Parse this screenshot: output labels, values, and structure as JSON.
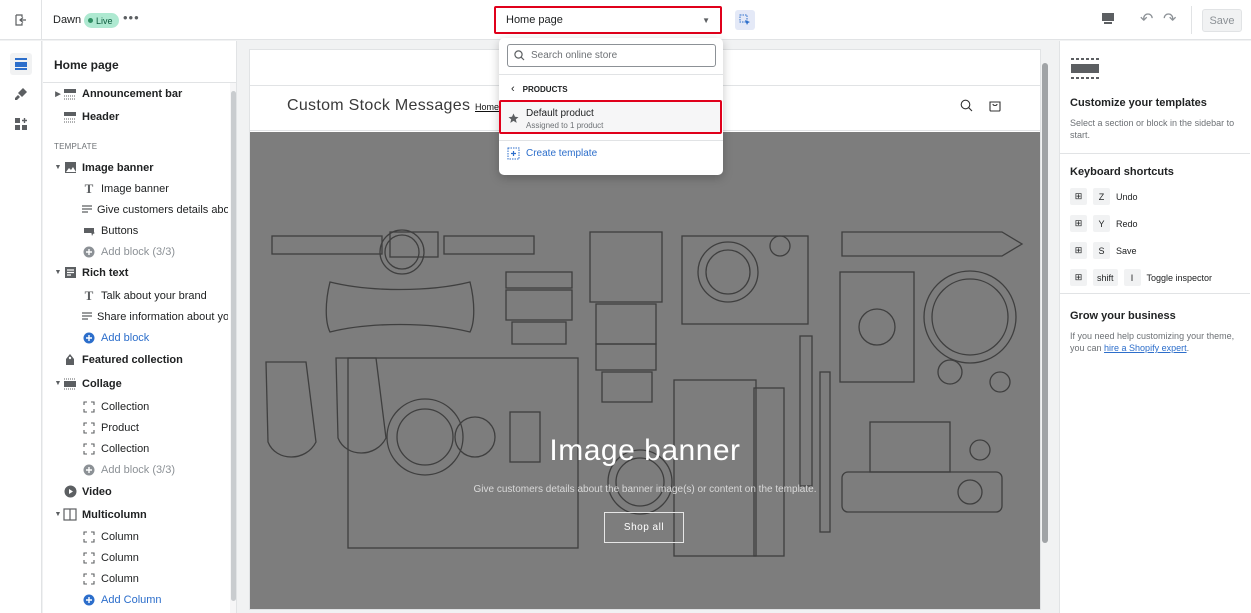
{
  "topbar": {
    "theme_name": "Dawn",
    "live_badge": "Live",
    "more_label": "•••",
    "page_selector": "Home page",
    "save_label": "Save"
  },
  "dropdown": {
    "search_placeholder": "Search online store",
    "back_label": "PRODUCTS",
    "option_name": "Default product",
    "option_meta": "Assigned to 1 product",
    "create_label": "Create template"
  },
  "sidebar": {
    "title": "Home page",
    "section_template": "TEMPLATE",
    "rows": [
      {
        "label": "Announcement bar",
        "style": "bold"
      },
      {
        "label": "Header",
        "style": "bold"
      },
      {
        "label": "Image banner",
        "style": "bold"
      },
      {
        "label": "Image banner",
        "style": "normal"
      },
      {
        "label": "Give customers details abo...",
        "style": "normal"
      },
      {
        "label": "Buttons",
        "style": "normal"
      },
      {
        "label": "Add block (3/3)",
        "style": "gray"
      },
      {
        "label": "Rich text",
        "style": "bold"
      },
      {
        "label": "Talk about your brand",
        "style": "normal"
      },
      {
        "label": "Share information about yo...",
        "style": "normal"
      },
      {
        "label": "Add block",
        "style": "blue"
      },
      {
        "label": "Featured collection",
        "style": "bold"
      },
      {
        "label": "Collage",
        "style": "bold"
      },
      {
        "label": "Collection",
        "style": "normal"
      },
      {
        "label": "Product",
        "style": "normal"
      },
      {
        "label": "Collection",
        "style": "normal"
      },
      {
        "label": "Add block (3/3)",
        "style": "gray"
      },
      {
        "label": "Video",
        "style": "bold"
      },
      {
        "label": "Multicolumn",
        "style": "bold"
      },
      {
        "label": "Column",
        "style": "normal"
      },
      {
        "label": "Column",
        "style": "normal"
      },
      {
        "label": "Column",
        "style": "normal"
      },
      {
        "label": "Add Column",
        "style": "blue"
      }
    ]
  },
  "store": {
    "logo": "Custom Stock Messages",
    "nav_link": "Home",
    "banner_heading": "Image banner",
    "banner_sub": "Give customers details about the banner image(s) or content on the template.",
    "banner_cta": "Shop all"
  },
  "right_panel": {
    "customize_title": "Customize your templates",
    "customize_text": "Select a section or block in the sidebar to start.",
    "shortcuts_title": "Keyboard shortcuts",
    "shortcuts": [
      {
        "keys": [
          "⊞",
          "Z"
        ],
        "label": "Undo"
      },
      {
        "keys": [
          "⊞",
          "Y"
        ],
        "label": "Redo"
      },
      {
        "keys": [
          "⊞",
          "S"
        ],
        "label": "Save"
      },
      {
        "keys": [
          "⊞",
          "shift",
          "I"
        ],
        "label": "Toggle inspector"
      }
    ],
    "grow_title": "Grow your business",
    "grow_text_pre": "If you need help customizing your theme, you can ",
    "grow_link": "hire a Shopify expert",
    "grow_text_post": "."
  },
  "colors": {
    "accent": "#2c6ecb",
    "highlight": "#e0001b",
    "live_badge": "#aee9d1"
  }
}
